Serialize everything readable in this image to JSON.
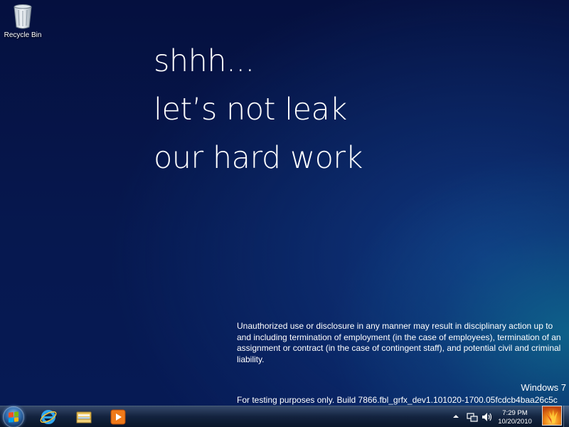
{
  "desktop": {
    "icons": [
      {
        "label": "Recycle Bin",
        "icon": "recycle-bin-icon"
      }
    ]
  },
  "headline": {
    "lines": [
      "shhh...",
      "let’s not leak",
      "our hard work"
    ]
  },
  "notice": {
    "text": "Unauthorized use or disclosure in any manner may result in disciplinary action up to and including termination of employment (in the case of employees), termination of an assignment or contract (in the case of contingent staff), and potential civil and criminal liability."
  },
  "watermark": {
    "os": "Windows 7",
    "build": "For testing purposes only. Build 7866.fbl_grfx_dev1.101020-1700.05fcdcb4baa26c5c"
  },
  "taskbar": {
    "start": {
      "icon": "windows-logo-icon"
    },
    "pinned": [
      {
        "icon": "internet-explorer-icon"
      },
      {
        "icon": "windows-explorer-icon"
      },
      {
        "icon": "media-player-icon"
      }
    ],
    "tray": {
      "overflow_icon": "chevron-up-icon",
      "network_icon": "network-icon",
      "volume_icon": "speaker-icon"
    },
    "clock": {
      "time": "7:29 PM",
      "date": "10/20/2010"
    },
    "user_tile_icon": "user-picture-flower"
  },
  "colors": {
    "background_top": "#05103f",
    "background_glow": "#108ca0",
    "text": "#ffffff"
  }
}
